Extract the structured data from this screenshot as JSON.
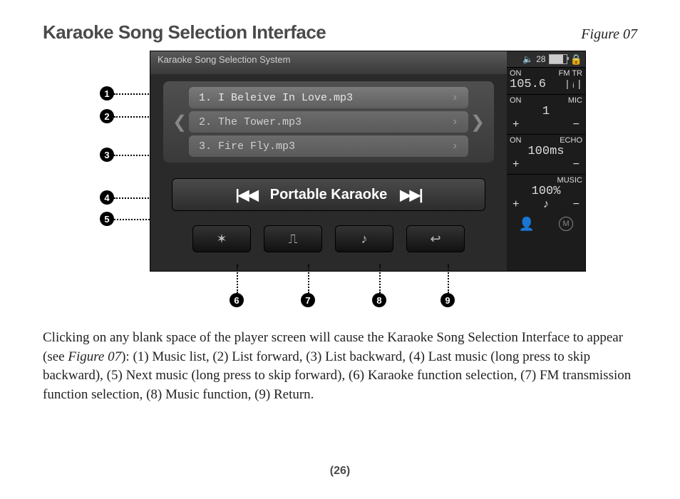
{
  "header": {
    "title": "Karaoke Song Selection Interface",
    "figure_label": "Figure 07"
  },
  "screen": {
    "title_bar": "Karaoke Song Selection System",
    "songs": [
      "1. I Beleive In Love.mp3",
      "2. The Tower.mp3",
      "3. Fire Fly.mp3"
    ],
    "transport_label": "Portable Karaoke"
  },
  "side_panel": {
    "volume_value": "28",
    "fm": {
      "on_label": "ON",
      "mode_label": "FM TR",
      "frequency": "105.6"
    },
    "mic": {
      "on_label": "ON",
      "mode_label": "MIC",
      "value": "1"
    },
    "echo": {
      "on_label": "ON",
      "mode_label": "ECHO",
      "value": "100ms"
    },
    "music": {
      "mode_label": "MUSIC",
      "value": "100%"
    }
  },
  "callouts": {
    "c1": "1",
    "c2": "2",
    "c3": "3",
    "c4": "4",
    "c5": "5",
    "c6": "6",
    "c7": "7",
    "c8": "8",
    "c9": "9"
  },
  "body": {
    "p1a": "Clicking on any blank space of the player screen will cause the Karaoke Song Selection Interface to appear (see ",
    "p1_ref": "Figure 07",
    "p1b": "): (1) Music list, (2) List forward, (3) List backward, (4) Last music (long press to skip backward), (5) Next music (long press to skip forward), (6) Karaoke function selection, (7) FM transmission function selection, (8) Music function, (9) Return."
  },
  "page_number": "(26)"
}
